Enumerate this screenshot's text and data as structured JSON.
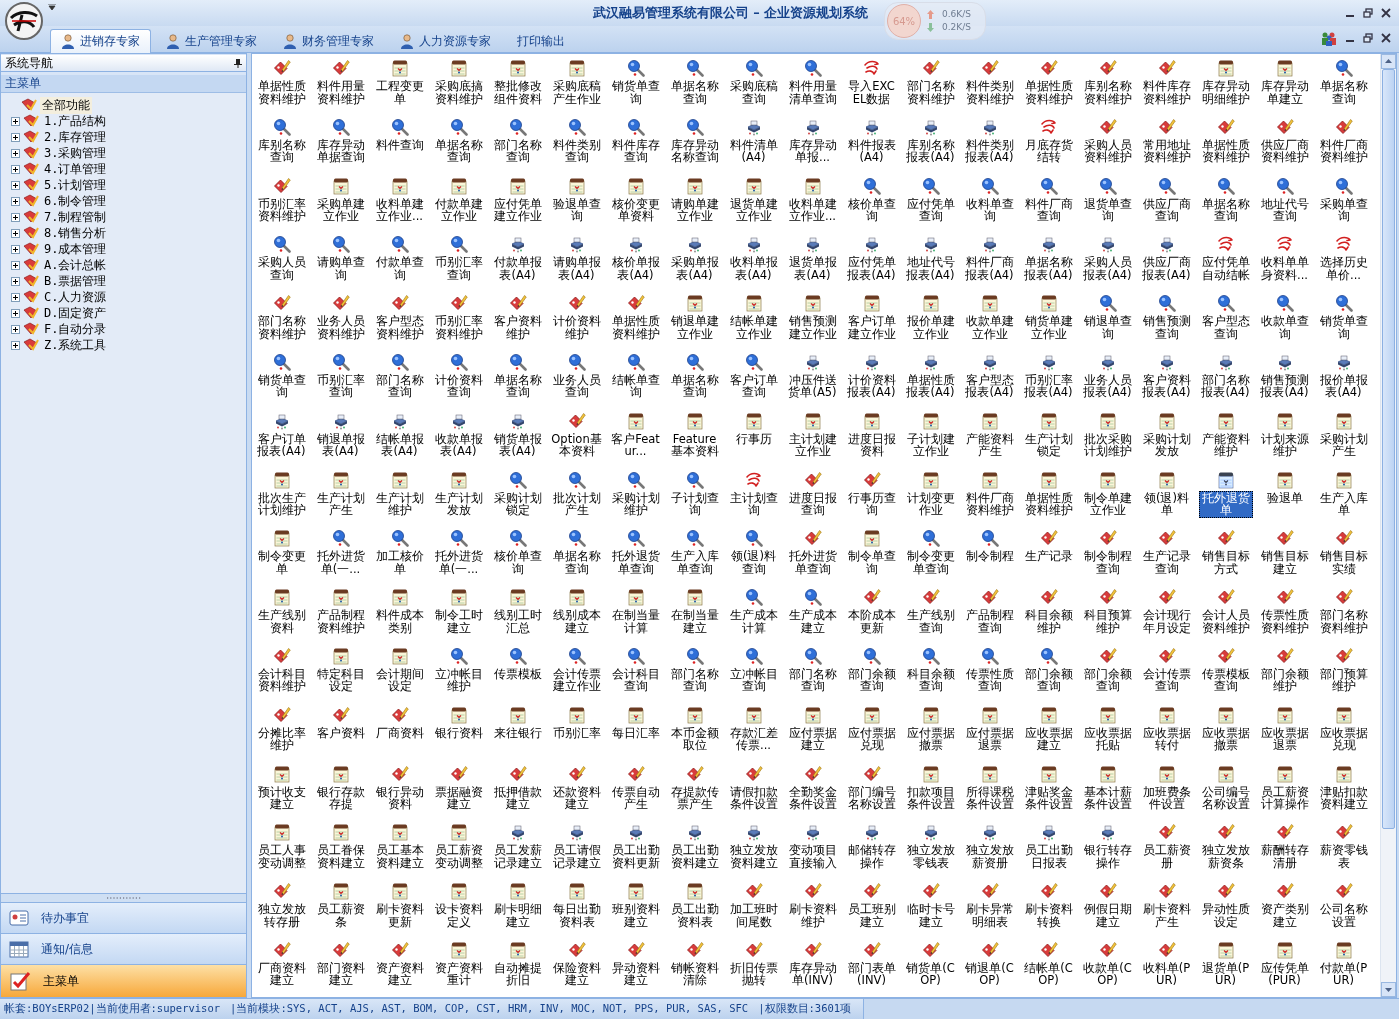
{
  "window": {
    "title": "武汉融易管理系统有限公司 – 企业资源规划系统"
  },
  "net_monitor": {
    "percent": "64%",
    "upload": "0.6K/S",
    "download": "0.2K/S"
  },
  "tabs": [
    {
      "label": "进销存专家",
      "selected": true
    },
    {
      "label": "生产管理专家",
      "selected": false
    },
    {
      "label": "财务管理专家",
      "selected": false
    },
    {
      "label": "人力资源专家",
      "selected": false
    },
    {
      "label": "打印输出",
      "selected": false
    }
  ],
  "sidebar": {
    "title": "系统导航",
    "section": "主菜单",
    "tree": {
      "label": "全部功能",
      "selected": true,
      "children": [
        {
          "label": "1.产品结构",
          "expanded": false,
          "selected": false
        },
        {
          "label": "2.库存管理",
          "expanded": false,
          "selected": false
        },
        {
          "label": "3.采购管理",
          "expanded": false,
          "selected": false
        },
        {
          "label": "4.订单管理",
          "expanded": false,
          "selected": false
        },
        {
          "label": "5.计划管理",
          "expanded": false,
          "selected": false
        },
        {
          "label": "6.制令管理",
          "expanded": false,
          "selected": false
        },
        {
          "label": "7.制程管制",
          "expanded": false,
          "selected": false
        },
        {
          "label": "8.销售分析",
          "expanded": false,
          "selected": false
        },
        {
          "label": "9.成本管理",
          "expanded": false,
          "selected": false
        },
        {
          "label": "A.会计总帐",
          "expanded": false,
          "selected": false
        },
        {
          "label": "B.票据管理",
          "expanded": false,
          "selected": false
        },
        {
          "label": "C.人力资源",
          "expanded": false,
          "selected": false
        },
        {
          "label": "D.固定资产",
          "expanded": false,
          "selected": false
        },
        {
          "label": "F.自动分录",
          "expanded": false,
          "selected": false
        },
        {
          "label": "Z.系统工具",
          "expanded": false,
          "selected": false
        }
      ]
    },
    "nav": [
      {
        "label": "待办事宜",
        "kind": "todo",
        "selected": false
      },
      {
        "label": "通知/信息",
        "kind": "calendar",
        "selected": false
      },
      {
        "label": "主菜单",
        "kind": "menu",
        "selected": true
      }
    ]
  },
  "functions": [
    {
      "label": "单据性质资料维护",
      "kind": "edit",
      "selected": false
    },
    {
      "label": "料件用量资料维护",
      "kind": "edit",
      "selected": false
    },
    {
      "label": "工程变更单",
      "kind": "form",
      "selected": false
    },
    {
      "label": "采购底搞资料维护",
      "kind": "form",
      "selected": false
    },
    {
      "label": "整批修改组件资料",
      "kind": "form",
      "selected": false
    },
    {
      "label": "采购底稿产生作业",
      "kind": "form",
      "selected": false
    },
    {
      "label": "销货单查询",
      "kind": "query",
      "selected": false
    },
    {
      "label": "单据名称查询",
      "kind": "query",
      "selected": false
    },
    {
      "label": "采购底稿查询",
      "kind": "query",
      "selected": false
    },
    {
      "label": "料件用量清单查询",
      "kind": "query",
      "selected": false
    },
    {
      "label": "导入EXCEL数据",
      "kind": "process",
      "selected": false
    },
    {
      "label": "部门名称资料维护",
      "kind": "edit",
      "selected": false
    },
    {
      "label": "料件类别资料维护",
      "kind": "edit",
      "selected": false
    },
    {
      "label": "单据性质资料维护",
      "kind": "edit",
      "selected": false
    },
    {
      "label": "库别名称资料维护",
      "kind": "edit",
      "selected": false
    },
    {
      "label": "料件库存资料维护",
      "kind": "edit",
      "selected": false
    },
    {
      "label": "库存异动明细维护",
      "kind": "form",
      "selected": false
    },
    {
      "label": "库存异动单建立",
      "kind": "form",
      "selected": false
    },
    {
      "label": "单据名称查询",
      "kind": "query",
      "selected": false
    },
    {
      "label": "库别名称查询",
      "kind": "query",
      "selected": false
    },
    {
      "label": "库存异动单据查询",
      "kind": "query",
      "selected": false
    },
    {
      "label": "料件查询",
      "kind": "query",
      "selected": false
    },
    {
      "label": "单据名称查询",
      "kind": "query",
      "selected": false
    },
    {
      "label": "部门名称查询",
      "kind": "query",
      "selected": false
    },
    {
      "label": "料件类别查询",
      "kind": "query",
      "selected": false
    },
    {
      "label": "料件库存查询",
      "kind": "query",
      "selected": false
    },
    {
      "label": "库存异动名称查询",
      "kind": "query",
      "selected": false
    },
    {
      "label": "料件清单(A4)",
      "kind": "report",
      "selected": false
    },
    {
      "label": "库存异动单报...",
      "kind": "report",
      "selected": false
    },
    {
      "label": "料件报表(A4)",
      "kind": "report",
      "selected": false
    },
    {
      "label": "库别名称报表(A4)",
      "kind": "report",
      "selected": false
    },
    {
      "label": "料件类别报表(A4)",
      "kind": "report",
      "selected": false
    },
    {
      "label": "月底存货结转",
      "kind": "process",
      "selected": false
    },
    {
      "label": "采购人员资料维护",
      "kind": "edit",
      "selected": false
    },
    {
      "label": "常用地址资料维护",
      "kind": "edit",
      "selected": false
    },
    {
      "label": "单据性质资料维护",
      "kind": "edit",
      "selected": false
    },
    {
      "label": "供应厂商资料维护",
      "kind": "edit",
      "selected": false
    },
    {
      "label": "料件厂商资料维护",
      "kind": "edit",
      "selected": false
    },
    {
      "label": "币别汇率资料维护",
      "kind": "edit",
      "selected": false
    },
    {
      "label": "采购单建立作业",
      "kind": "form",
      "selected": false
    },
    {
      "label": "收料单建立作业...",
      "kind": "form",
      "selected": false
    },
    {
      "label": "付款单建立作业",
      "kind": "form",
      "selected": false
    },
    {
      "label": "应付凭单建立作业",
      "kind": "form",
      "selected": false
    },
    {
      "label": "验退单查询",
      "kind": "form",
      "selected": false
    },
    {
      "label": "核价变更单资料",
      "kind": "form",
      "selected": false
    },
    {
      "label": "请购单建立作业",
      "kind": "form",
      "selected": false
    },
    {
      "label": "退货单建立作业",
      "kind": "form",
      "selected": false
    },
    {
      "label": "收料单建立作业...",
      "kind": "form",
      "selected": false
    },
    {
      "label": "核价单查询",
      "kind": "query",
      "selected": false
    },
    {
      "label": "应付凭单查询",
      "kind": "query",
      "selected": false
    },
    {
      "label": "收料单查询",
      "kind": "query",
      "selected": false
    },
    {
      "label": "料件厂商查询",
      "kind": "query",
      "selected": false
    },
    {
      "label": "退货单查询",
      "kind": "query",
      "selected": false
    },
    {
      "label": "供应厂商查询",
      "kind": "query",
      "selected": false
    },
    {
      "label": "单据名称查询",
      "kind": "query",
      "selected": false
    },
    {
      "label": "地址代号查询",
      "kind": "query",
      "selected": false
    },
    {
      "label": "采购单查询",
      "kind": "query",
      "selected": false
    },
    {
      "label": "采购人员查询",
      "kind": "query",
      "selected": false
    },
    {
      "label": "请购单查询",
      "kind": "query",
      "selected": false
    },
    {
      "label": "付款单查询",
      "kind": "query",
      "selected": false
    },
    {
      "label": "币别汇率查询",
      "kind": "query",
      "selected": false
    },
    {
      "label": "付款单报表(A4)",
      "kind": "report",
      "selected": false
    },
    {
      "label": "请购单报表(A4)",
      "kind": "report",
      "selected": false
    },
    {
      "label": "核价单报表(A4)",
      "kind": "report",
      "selected": false
    },
    {
      "label": "采购单报表(A4)",
      "kind": "report",
      "selected": false
    },
    {
      "label": "收料单报表(A4)",
      "kind": "report",
      "selected": false
    },
    {
      "label": "退货单报表(A4)",
      "kind": "report",
      "selected": false
    },
    {
      "label": "应付凭单报表(A4)",
      "kind": "report",
      "selected": false
    },
    {
      "label": "地址代号报表(A4)",
      "kind": "report",
      "selected": false
    },
    {
      "label": "料件厂商报表(A4)",
      "kind": "report",
      "selected": false
    },
    {
      "label": "单据名称报表(A4)",
      "kind": "report",
      "selected": false
    },
    {
      "label": "采购人员报表(A4)",
      "kind": "report",
      "selected": false
    },
    {
      "label": "供应厂商报表(A4)",
      "kind": "report",
      "selected": false
    },
    {
      "label": "应付凭单自动结帐",
      "kind": "process",
      "selected": false
    },
    {
      "label": "收料单单身资料...",
      "kind": "process",
      "selected": false
    },
    {
      "label": "选择历史单价...",
      "kind": "process",
      "selected": false
    },
    {
      "label": "部门名称资料维护",
      "kind": "edit",
      "selected": false
    },
    {
      "label": "业务人员资料维护",
      "kind": "edit",
      "selected": false
    },
    {
      "label": "客户型态资料维护",
      "kind": "edit",
      "selected": false
    },
    {
      "label": "币别汇率资料维护",
      "kind": "edit",
      "selected": false
    },
    {
      "label": "客户资料维护",
      "kind": "edit",
      "selected": false
    },
    {
      "label": "计价资料维护",
      "kind": "edit",
      "selected": false
    },
    {
      "label": "单据性质资料维护",
      "kind": "edit",
      "selected": false
    },
    {
      "label": "销退单建立作业",
      "kind": "form",
      "selected": false
    },
    {
      "label": "结帐单建立作业",
      "kind": "form",
      "selected": false
    },
    {
      "label": "销售预测建立作业",
      "kind": "form",
      "selected": false
    },
    {
      "label": "客户订单建立作业",
      "kind": "form",
      "selected": false
    },
    {
      "label": "报价单建立作业",
      "kind": "form",
      "selected": false
    },
    {
      "label": "收款单建立作业",
      "kind": "form",
      "selected": false
    },
    {
      "label": "销货单建立作业",
      "kind": "form",
      "selected": false
    },
    {
      "label": "销退单查询",
      "kind": "query",
      "selected": false
    },
    {
      "label": "销售预测查询",
      "kind": "query",
      "selected": false
    },
    {
      "label": "客户型态查询",
      "kind": "query",
      "selected": false
    },
    {
      "label": "收款单查询",
      "kind": "query",
      "selected": false
    },
    {
      "label": "销货单查询",
      "kind": "query",
      "selected": false
    },
    {
      "label": "销货单查询",
      "kind": "query",
      "selected": false
    },
    {
      "label": "币别汇率查询",
      "kind": "query",
      "selected": false
    },
    {
      "label": "部门名称查询",
      "kind": "query",
      "selected": false
    },
    {
      "label": "计价资料查询",
      "kind": "query",
      "selected": false
    },
    {
      "label": "单据名称查询",
      "kind": "query",
      "selected": false
    },
    {
      "label": "业务人员查询",
      "kind": "query",
      "selected": false
    },
    {
      "label": "结帐单查询",
      "kind": "query",
      "selected": false
    },
    {
      "label": "单据名称查询",
      "kind": "query",
      "selected": false
    },
    {
      "label": "客户订单查询",
      "kind": "query",
      "selected": false
    },
    {
      "label": "冲压件送货单(A5)",
      "kind": "report",
      "selected": false
    },
    {
      "label": "计价资料报表(A4)",
      "kind": "report",
      "selected": false
    },
    {
      "label": "单据性质报表(A4)",
      "kind": "report",
      "selected": false
    },
    {
      "label": "客户型态报表(A4)",
      "kind": "report",
      "selected": false
    },
    {
      "label": "币别汇率报表(A4)",
      "kind": "report",
      "selected": false
    },
    {
      "label": "业务人员报表(A4)",
      "kind": "report",
      "selected": false
    },
    {
      "label": "客户资料报表(A4)",
      "kind": "report",
      "selected": false
    },
    {
      "label": "部门名称报表(A4)",
      "kind": "report",
      "selected": false
    },
    {
      "label": "销售预测报表(A4)",
      "kind": "report",
      "selected": false
    },
    {
      "label": "报价单报表(A4)",
      "kind": "report",
      "selected": false
    },
    {
      "label": "客户订单报表(A4)",
      "kind": "report",
      "selected": false
    },
    {
      "label": "销退单报表(A4)",
      "kind": "report",
      "selected": false
    },
    {
      "label": "结帐单报表(A4)",
      "kind": "report",
      "selected": false
    },
    {
      "label": "收款单报表(A4)",
      "kind": "report",
      "selected": false
    },
    {
      "label": "销货单报表(A4)",
      "kind": "report",
      "selected": false
    },
    {
      "label": "Option基本资料",
      "kind": "edit",
      "selected": false
    },
    {
      "label": "客户Featur...",
      "kind": "form",
      "selected": false
    },
    {
      "label": "Feature基本资料",
      "kind": "form",
      "selected": false
    },
    {
      "label": "行事历",
      "kind": "form",
      "selected": false
    },
    {
      "label": "主计划建立作业",
      "kind": "form",
      "selected": false
    },
    {
      "label": "进度日报资料",
      "kind": "form",
      "selected": false
    },
    {
      "label": "子计划建立作业",
      "kind": "form",
      "selected": false
    },
    {
      "label": "产能资料产生",
      "kind": "form",
      "selected": false
    },
    {
      "label": "生产计划锁定",
      "kind": "form",
      "selected": false
    },
    {
      "label": "批次采购计划维护",
      "kind": "form",
      "selected": false
    },
    {
      "label": "采购计划发放",
      "kind": "form",
      "selected": false
    },
    {
      "label": "产能资料维护",
      "kind": "form",
      "selected": false
    },
    {
      "label": "计划来源维护",
      "kind": "form",
      "selected": false
    },
    {
      "label": "采购计划产生",
      "kind": "form",
      "selected": false
    },
    {
      "label": "批次生产计划维护",
      "kind": "form",
      "selected": false
    },
    {
      "label": "生产计划产生",
      "kind": "form",
      "selected": false
    },
    {
      "label": "生产计划维护",
      "kind": "form",
      "selected": false
    },
    {
      "label": "生产计划发放",
      "kind": "form",
      "selected": false
    },
    {
      "label": "采购计划锁定",
      "kind": "query",
      "selected": false
    },
    {
      "label": "批次计划产生",
      "kind": "query",
      "selected": false
    },
    {
      "label": "采购计划维护",
      "kind": "query",
      "selected": false
    },
    {
      "label": "子计划查询",
      "kind": "query",
      "selected": false
    },
    {
      "label": "主计划查询",
      "kind": "process",
      "selected": false
    },
    {
      "label": "进度日报查询",
      "kind": "edit",
      "selected": false
    },
    {
      "label": "行事历查询",
      "kind": "edit",
      "selected": false
    },
    {
      "label": "计划变更作业",
      "kind": "form",
      "selected": false
    },
    {
      "label": "料件厂商资料维护",
      "kind": "form",
      "selected": false
    },
    {
      "label": "单据性质资料维护",
      "kind": "form",
      "selected": false
    },
    {
      "label": "制令单建立作业",
      "kind": "form",
      "selected": false
    },
    {
      "label": "领(退)料单",
      "kind": "form",
      "selected": false
    },
    {
      "label": "托外退货单",
      "kind": "form",
      "selected": true
    },
    {
      "label": "验退单",
      "kind": "form",
      "selected": false
    },
    {
      "label": "生产入库单",
      "kind": "form",
      "selected": false
    },
    {
      "label": "制令变更单",
      "kind": "form",
      "selected": false
    },
    {
      "label": "托外进货单(一...",
      "kind": "query",
      "selected": false
    },
    {
      "label": "加工核价单",
      "kind": "query",
      "selected": false
    },
    {
      "label": "托外进货单(一...",
      "kind": "query",
      "selected": false
    },
    {
      "label": "核价单查询",
      "kind": "query",
      "selected": false
    },
    {
      "label": "单据名称查询",
      "kind": "query",
      "selected": false
    },
    {
      "label": "托外退货单查询",
      "kind": "query",
      "selected": false
    },
    {
      "label": "生产入库单查询",
      "kind": "query",
      "selected": false
    },
    {
      "label": "领(退)料查询",
      "kind": "query",
      "selected": false
    },
    {
      "label": "托外进货单查询",
      "kind": "edit",
      "selected": false
    },
    {
      "label": "制令单查询",
      "kind": "form",
      "selected": false
    },
    {
      "label": "制令变更单查询",
      "kind": "query",
      "selected": false
    },
    {
      "label": "制令制程",
      "kind": "query",
      "selected": false
    },
    {
      "label": "生产记录",
      "kind": "edit",
      "selected": false
    },
    {
      "label": "制令制程查询",
      "kind": "edit",
      "selected": false
    },
    {
      "label": "生产记录查询",
      "kind": "edit",
      "selected": false
    },
    {
      "label": "销售目标方式",
      "kind": "edit",
      "selected": false
    },
    {
      "label": "销售目标建立",
      "kind": "edit",
      "selected": false
    },
    {
      "label": "销售目标实绩",
      "kind": "edit",
      "selected": false
    },
    {
      "label": "生产线别资料",
      "kind": "form",
      "selected": false
    },
    {
      "label": "产品制程资料维护",
      "kind": "form",
      "selected": false
    },
    {
      "label": "料件成本类别",
      "kind": "form",
      "selected": false
    },
    {
      "label": "制令工时建立",
      "kind": "form",
      "selected": false
    },
    {
      "label": "线别工时汇总",
      "kind": "form",
      "selected": false
    },
    {
      "label": "线别成本建立",
      "kind": "form",
      "selected": false
    },
    {
      "label": "在制当量计算",
      "kind": "form",
      "selected": false
    },
    {
      "label": "在制当量建立",
      "kind": "form",
      "selected": false
    },
    {
      "label": "生产成本计算",
      "kind": "query",
      "selected": false
    },
    {
      "label": "生产成本建立",
      "kind": "query",
      "selected": false
    },
    {
      "label": "本阶成本更新",
      "kind": "edit",
      "selected": false
    },
    {
      "label": "生产线别查询",
      "kind": "edit",
      "selected": false
    },
    {
      "label": "产品制程查询",
      "kind": "edit",
      "selected": false
    },
    {
      "label": "科目余额维护",
      "kind": "edit",
      "selected": false
    },
    {
      "label": "科目预算维护",
      "kind": "edit",
      "selected": false
    },
    {
      "label": "会计现行年月设定",
      "kind": "edit",
      "selected": false
    },
    {
      "label": "会计人员资料维护",
      "kind": "edit",
      "selected": false
    },
    {
      "label": "传票性质资料维护",
      "kind": "edit",
      "selected": false
    },
    {
      "label": "部门名称资料维护",
      "kind": "edit",
      "selected": false
    },
    {
      "label": "会计科目资料维护",
      "kind": "edit",
      "selected": false
    },
    {
      "label": "特定科目设定",
      "kind": "form",
      "selected": false
    },
    {
      "label": "会计期间设定",
      "kind": "form",
      "selected": false
    },
    {
      "label": "立冲帐目维护",
      "kind": "query",
      "selected": false
    },
    {
      "label": "传票模板",
      "kind": "query",
      "selected": false
    },
    {
      "label": "会计传票建立作业",
      "kind": "query",
      "selected": false
    },
    {
      "label": "会计科目查询",
      "kind": "query",
      "selected": false
    },
    {
      "label": "部门名称查询",
      "kind": "query",
      "selected": false
    },
    {
      "label": "立冲帐目查询",
      "kind": "query",
      "selected": false
    },
    {
      "label": "部门名称查询",
      "kind": "query",
      "selected": false
    },
    {
      "label": "部门余额查询",
      "kind": "query",
      "selected": false
    },
    {
      "label": "科目余额查询",
      "kind": "query",
      "selected": false
    },
    {
      "label": "传票性质查询",
      "kind": "query",
      "selected": false
    },
    {
      "label": "部门余额查询",
      "kind": "query",
      "selected": false
    },
    {
      "label": "部门余额查询",
      "kind": "edit",
      "selected": false
    },
    {
      "label": "会计传票查询",
      "kind": "edit",
      "selected": false
    },
    {
      "label": "传票模板查询",
      "kind": "edit",
      "selected": false
    },
    {
      "label": "部门余额维护",
      "kind": "edit",
      "selected": false
    },
    {
      "label": "部门预算维护",
      "kind": "edit",
      "selected": false
    },
    {
      "label": "分摊比率维护",
      "kind": "edit",
      "selected": false
    },
    {
      "label": "客户资料",
      "kind": "edit",
      "selected": false
    },
    {
      "label": "厂商资料",
      "kind": "edit",
      "selected": false
    },
    {
      "label": "银行资料",
      "kind": "form",
      "selected": false
    },
    {
      "label": "来往银行",
      "kind": "form",
      "selected": false
    },
    {
      "label": "币别汇率",
      "kind": "form",
      "selected": false
    },
    {
      "label": "每日汇率",
      "kind": "form",
      "selected": false
    },
    {
      "label": "本币金额取位",
      "kind": "form",
      "selected": false
    },
    {
      "label": "存款汇差传票...",
      "kind": "form",
      "selected": false
    },
    {
      "label": "应付票据建立",
      "kind": "form",
      "selected": false
    },
    {
      "label": "应付票据兑现",
      "kind": "form",
      "selected": false
    },
    {
      "label": "应付票据撤票",
      "kind": "form",
      "selected": false
    },
    {
      "label": "应付票据退票",
      "kind": "form",
      "selected": false
    },
    {
      "label": "应收票据建立",
      "kind": "form",
      "selected": false
    },
    {
      "label": "应收票据托贴",
      "kind": "form",
      "selected": false
    },
    {
      "label": "应收票据转付",
      "kind": "form",
      "selected": false
    },
    {
      "label": "应收票据撤票",
      "kind": "form",
      "selected": false
    },
    {
      "label": "应收票据退票",
      "kind": "form",
      "selected": false
    },
    {
      "label": "应收票据兑现",
      "kind": "form",
      "selected": false
    },
    {
      "label": "预计收支建立",
      "kind": "form",
      "selected": false
    },
    {
      "label": "银行存款存提",
      "kind": "form",
      "selected": false
    },
    {
      "label": "银行异动资料",
      "kind": "edit",
      "selected": false
    },
    {
      "label": "票据融资建立",
      "kind": "edit",
      "selected": false
    },
    {
      "label": "抵押借款建立",
      "kind": "edit",
      "selected": false
    },
    {
      "label": "还款资料建立",
      "kind": "edit",
      "selected": false
    },
    {
      "label": "传票自动产生",
      "kind": "edit",
      "selected": false
    },
    {
      "label": "存提款传票产生",
      "kind": "edit",
      "selected": false
    },
    {
      "label": "请假扣款条件设置",
      "kind": "edit",
      "selected": false
    },
    {
      "label": "全勤奖金条件设置",
      "kind": "edit",
      "selected": false
    },
    {
      "label": "部门编号名称设置",
      "kind": "edit",
      "selected": false
    },
    {
      "label": "扣款项目条件设置",
      "kind": "form",
      "selected": false
    },
    {
      "label": "所得课税条件设置",
      "kind": "form",
      "selected": false
    },
    {
      "label": "津贴奖金条件设置",
      "kind": "form",
      "selected": false
    },
    {
      "label": "基本计薪条件设置",
      "kind": "form",
      "selected": false
    },
    {
      "label": "加班费条件设置",
      "kind": "form",
      "selected": false
    },
    {
      "label": "公司编号名称设置",
      "kind": "form",
      "selected": false
    },
    {
      "label": "员工薪资计算操作",
      "kind": "form",
      "selected": false
    },
    {
      "label": "津贴扣款资料建立",
      "kind": "form",
      "selected": false
    },
    {
      "label": "员工人事变动调整",
      "kind": "form",
      "selected": false
    },
    {
      "label": "员工眷保资料建立",
      "kind": "form",
      "selected": false
    },
    {
      "label": "员工基本资料建立",
      "kind": "form",
      "selected": false
    },
    {
      "label": "员工薪资变动调整",
      "kind": "form",
      "selected": false
    },
    {
      "label": "员工发薪记录建立",
      "kind": "report",
      "selected": false
    },
    {
      "label": "员工请假记录建立",
      "kind": "report",
      "selected": false
    },
    {
      "label": "员工出勤资料更新",
      "kind": "report",
      "selected": false
    },
    {
      "label": "员工出勤资料建立",
      "kind": "report",
      "selected": false
    },
    {
      "label": "独立发放资料建立",
      "kind": "report",
      "selected": false
    },
    {
      "label": "变动项目直接输入",
      "kind": "report",
      "selected": false
    },
    {
      "label": "邮储转存操作",
      "kind": "report",
      "selected": false
    },
    {
      "label": "独立发放零钱表",
      "kind": "report",
      "selected": false
    },
    {
      "label": "独立发放薪资册",
      "kind": "report",
      "selected": false
    },
    {
      "label": "员工出勤日报表",
      "kind": "report",
      "selected": false
    },
    {
      "label": "银行转存操作",
      "kind": "report",
      "selected": false
    },
    {
      "label": "员工薪资册",
      "kind": "edit",
      "selected": false
    },
    {
      "label": "独立发放薪资条",
      "kind": "edit",
      "selected": false
    },
    {
      "label": "薪酬转存清册",
      "kind": "edit",
      "selected": false
    },
    {
      "label": "薪资零钱表",
      "kind": "edit",
      "selected": false
    },
    {
      "label": "独立发放转存册",
      "kind": "edit",
      "selected": false
    },
    {
      "label": "员工薪资条",
      "kind": "form",
      "selected": false
    },
    {
      "label": "刷卡资料更新",
      "kind": "form",
      "selected": false
    },
    {
      "label": "设卡资料定义",
      "kind": "form",
      "selected": false
    },
    {
      "label": "刷卡明细建立",
      "kind": "form",
      "selected": false
    },
    {
      "label": "每日出勤资料表",
      "kind": "form",
      "selected": false
    },
    {
      "label": "班别资料建立",
      "kind": "form",
      "selected": false
    },
    {
      "label": "员工出勤资料表",
      "kind": "form",
      "selected": false
    },
    {
      "label": "加工班时间尾数",
      "kind": "edit",
      "selected": false
    },
    {
      "label": "刷卡资料维护",
      "kind": "edit",
      "selected": false
    },
    {
      "label": "员工班别建立",
      "kind": "edit",
      "selected": false
    },
    {
      "label": "临时卡号建立",
      "kind": "edit",
      "selected": false
    },
    {
      "label": "刷卡异常明细表",
      "kind": "edit",
      "selected": false
    },
    {
      "label": "刷卡资料转换",
      "kind": "edit",
      "selected": false
    },
    {
      "label": "例假日期建立",
      "kind": "edit",
      "selected": false
    },
    {
      "label": "刷卡资料产生",
      "kind": "edit",
      "selected": false
    },
    {
      "label": "异动性质设定",
      "kind": "edit",
      "selected": false
    },
    {
      "label": "资产类别建立",
      "kind": "edit",
      "selected": false
    },
    {
      "label": "公司名称设置",
      "kind": "edit",
      "selected": false
    },
    {
      "label": "厂商资料建立",
      "kind": "edit",
      "selected": false
    },
    {
      "label": "部门资料建立",
      "kind": "edit",
      "selected": false
    },
    {
      "label": "资产资料建立",
      "kind": "edit",
      "selected": false
    },
    {
      "label": "资产资料重计",
      "kind": "form",
      "selected": false
    },
    {
      "label": "自动摊提折旧",
      "kind": "form",
      "selected": false
    },
    {
      "label": "保险资料建立",
      "kind": "edit",
      "selected": false
    },
    {
      "label": "异动资料建立",
      "kind": "edit",
      "selected": false
    },
    {
      "label": "销帐资料清除",
      "kind": "edit",
      "selected": false
    },
    {
      "label": "折旧传票抛转",
      "kind": "edit",
      "selected": false
    },
    {
      "label": "库存异动单(INV)",
      "kind": "edit",
      "selected": false
    },
    {
      "label": "部门表单(INV)",
      "kind": "edit",
      "selected": false
    },
    {
      "label": "销货单(COP)",
      "kind": "edit",
      "selected": false
    },
    {
      "label": "销退单(COP)",
      "kind": "edit",
      "selected": false
    },
    {
      "label": "结帐单(COP)",
      "kind": "edit",
      "selected": false
    },
    {
      "label": "收款单(COP)",
      "kind": "edit",
      "selected": false
    },
    {
      "label": "收料单(PUR)",
      "kind": "edit",
      "selected": false
    },
    {
      "label": "退货单(PUR)",
      "kind": "form",
      "selected": false
    },
    {
      "label": "应传凭单(PUR)",
      "kind": "form",
      "selected": false
    },
    {
      "label": "付款单(PUR)",
      "kind": "form",
      "selected": false
    }
  ],
  "status_bar": [
    "帐套:BOYsERP02|当前使用者:supervisor",
    "|当前模块:SYS, ACT, AJS, AST, BOM, COP, CST, HRM, INV, MOC, NOT, PPS, PUR, SAS, SFC",
    "|权限数目:3601项"
  ]
}
